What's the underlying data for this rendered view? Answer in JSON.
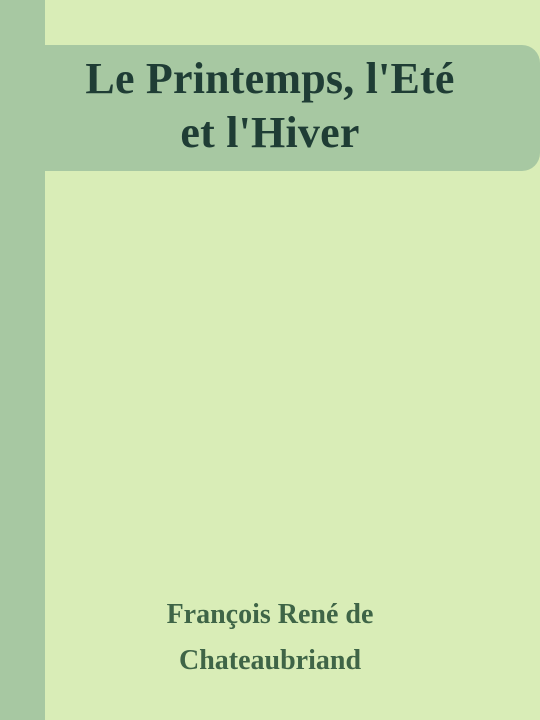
{
  "book": {
    "title_lines": [
      "Le Printemps, l'Eté",
      "et l'Hiver"
    ],
    "author_lines": [
      "François René de",
      "Chateaubriand"
    ]
  },
  "colors": {
    "background": "#d9edb7",
    "accent": "#a7c8a2",
    "title_text": "#1f3d35",
    "author_text": "#3f6547"
  }
}
